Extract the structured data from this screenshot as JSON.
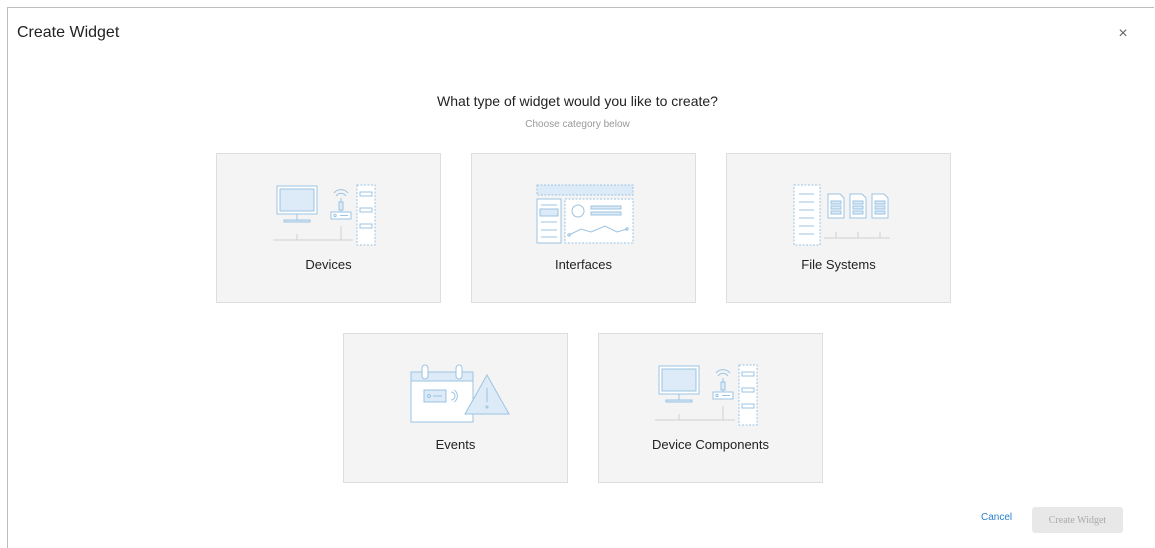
{
  "dialog": {
    "title": "Create Widget",
    "close_glyph": "×",
    "question": "What type of widget would you like to create?",
    "subtitle": "Choose category below"
  },
  "categories": [
    {
      "label": "Devices",
      "icon": "devices-icon"
    },
    {
      "label": "Interfaces",
      "icon": "interfaces-icon"
    },
    {
      "label": "File Systems",
      "icon": "file-systems-icon"
    },
    {
      "label": "Events",
      "icon": "events-icon"
    },
    {
      "label": "Device Components",
      "icon": "device-components-icon"
    }
  ],
  "footer": {
    "cancel_label": "Cancel",
    "create_label": "Create Widget"
  },
  "colors": {
    "icon_stroke": "#9cc3e2",
    "icon_fill": "#dcebf7",
    "card_bg": "#f4f4f4",
    "link": "#2a7fc9"
  }
}
